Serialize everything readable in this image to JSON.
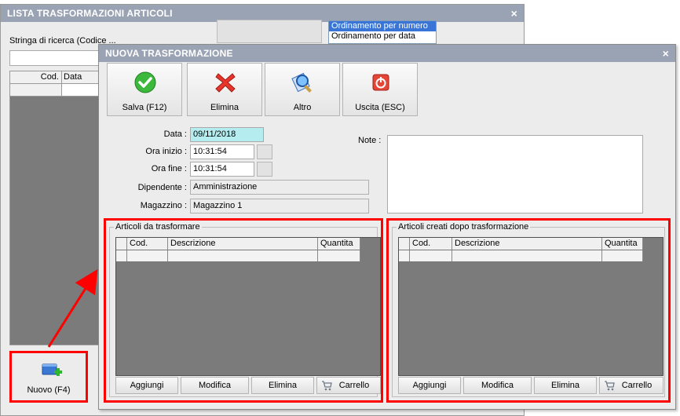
{
  "bg_window": {
    "title": "LISTA TRASFORMAZIONI ARTICOLI",
    "close": "×",
    "search_label": "Stringa di ricerca (Codice ...",
    "sort_options": [
      "Ordinamento per numero",
      "Ordinamento per data"
    ],
    "sort_selected": "Ordinamento per numero",
    "grid_headers": [
      "Cod.",
      "Data"
    ],
    "new_button": "Nuovo (F4)"
  },
  "dialog": {
    "title": "NUOVA TRASFORMAZIONE",
    "close": "×",
    "toolbar": [
      {
        "label": "Salva (F12)",
        "icon": "check-icon"
      },
      {
        "label": "Elimina",
        "icon": "delete-x-icon"
      },
      {
        "label": "Altro",
        "icon": "search-doc-icon"
      },
      {
        "label": "Uscita (ESC)",
        "icon": "power-icon"
      }
    ],
    "fields": {
      "data_label": "Data :",
      "data_value": "09/11/2018",
      "ora_inizio_label": "Ora inizio :",
      "ora_inizio_value": "10:31:54",
      "ora_fine_label": "Ora fine :",
      "ora_fine_value": "10:31:54",
      "dipendente_label": "Dipendente :",
      "dipendente_value": "Amministrazione",
      "magazzino_label": "Magazzino :",
      "magazzino_value": "Magazzino 1",
      "note_label": "Note :",
      "note_value": ""
    },
    "group_left": {
      "title": "Articoli da trasformare",
      "headers": [
        "Cod.",
        "Descrizione",
        "Quantita"
      ],
      "buttons": {
        "add": "Aggiungi",
        "edit": "Modifica",
        "delete": "Elimina",
        "cart": "Carrello"
      }
    },
    "group_right": {
      "title": "Articoli creati dopo trasformazione",
      "headers": [
        "Cod.",
        "Descrizione",
        "Quantita"
      ],
      "buttons": {
        "add": "Aggiungi",
        "edit": "Modifica",
        "delete": "Elimina",
        "cart": "Carrello"
      }
    }
  },
  "colors": {
    "title_bar": "#9aa3b3",
    "highlight": "#ff0000",
    "date_field": "#b5ecf0",
    "grid_bg": "#7b7b7b",
    "selection": "#3875d7"
  }
}
